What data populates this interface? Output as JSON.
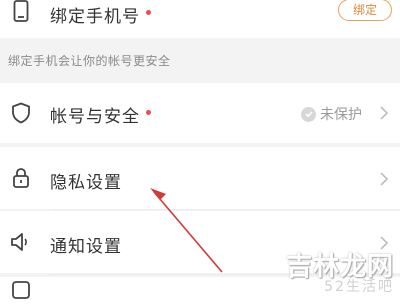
{
  "bind_phone": {
    "label": "绑定手机号",
    "button_label": "绑定",
    "dot_color": "#f04b4b"
  },
  "hint": {
    "text": "绑定手机会让你的帐号更安全"
  },
  "menu": {
    "account_security": {
      "label": "帐号与安全",
      "status": "未保护",
      "dot_color": "#f04b4b"
    },
    "privacy": {
      "label": "隐私设置"
    },
    "notifications": {
      "label": "通知设置"
    }
  },
  "watermark": {
    "text": "吉林龙网",
    "subtext": "52生活吧"
  },
  "colors": {
    "accent": "#e8a060",
    "annotation_arrow": "#d23a3a"
  }
}
